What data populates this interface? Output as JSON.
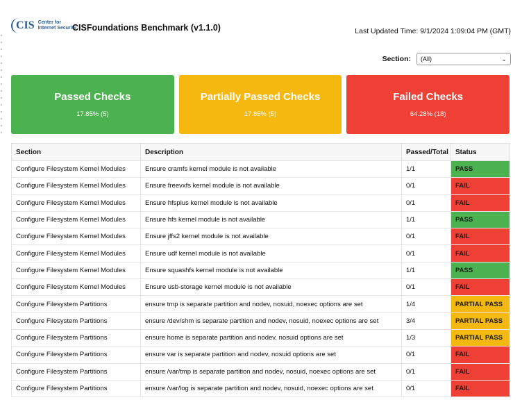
{
  "header": {
    "logo_mark": "CIS",
    "logo_line1": "Center for",
    "logo_line2": "Internet Security",
    "title": "CISFoundations Benchmark (v1.1.0)",
    "last_updated": "Last Updated Time: 9/1/2024 1:09:04 PM (GMT)"
  },
  "filter": {
    "label": "Section:",
    "selected": "(All)"
  },
  "cards": {
    "passed": {
      "title": "Passed Checks",
      "value": "17.85% (5)",
      "color": "#4cb14f"
    },
    "partial": {
      "title": "Partially Passed Checks",
      "value": "17.85% (5)",
      "color": "#f5b80f"
    },
    "failed": {
      "title": "Failed Checks",
      "value": "64.28% (18)",
      "color": "#ee4035"
    }
  },
  "table": {
    "columns": [
      "Section",
      "Description",
      "Passed/Total",
      "Status"
    ],
    "rows": [
      {
        "section": "Configure Filesystem Kernel Modules",
        "description": "Ensure cramfs kernel module is not available",
        "passed_total": "1/1",
        "status": "PASS"
      },
      {
        "section": "Configure Filesystem Kernel Modules",
        "description": "Ensure freevxfs kernel module is not available",
        "passed_total": "0/1",
        "status": "FAIL"
      },
      {
        "section": "Configure Filesystem Kernel Modules",
        "description": "Ensure hfsplus kernel module is not available",
        "passed_total": "0/1",
        "status": "FAIL"
      },
      {
        "section": "Configure Filesystem Kernel Modules",
        "description": "Ensure hfs kernel module is not available",
        "passed_total": "1/1",
        "status": "PASS"
      },
      {
        "section": "Configure Filesystem Kernel Modules",
        "description": "Ensure jffs2 kernel module is not available",
        "passed_total": "0/1",
        "status": "FAIL"
      },
      {
        "section": "Configure Filesystem Kernel Modules",
        "description": "Ensure udf kernel module is not available",
        "passed_total": "0/1",
        "status": "FAIL"
      },
      {
        "section": "Configure Filesystem Kernel Modules",
        "description": "Ensure squashfs kernel module is not available",
        "passed_total": "1/1",
        "status": "PASS"
      },
      {
        "section": "Configure Filesystem Kernel Modules",
        "description": "Ensure usb-storage kernel module is not available",
        "passed_total": "0/1",
        "status": "FAIL"
      },
      {
        "section": "Configure Filesystem Partitions",
        "description": "ensure tmp is separate partition and nodev, nosuid, noexec options are set",
        "passed_total": "1/4",
        "status": "PARTIAL PASS"
      },
      {
        "section": "Configure Filesystem Partitions",
        "description": "ensure /dev/shm is separate partition and nodev, nosuid, noexec options are set",
        "passed_total": "3/4",
        "status": "PARTIAL PASS"
      },
      {
        "section": "Configure Filesystem Partitions",
        "description": "ensure home is separate partition and nodev, nosuid options are set",
        "passed_total": "1/3",
        "status": "PARTIAL PASS"
      },
      {
        "section": "Configure Filesystem Partitions",
        "description": "ensure var is separate partition and nodev, nosuid options are set",
        "passed_total": "0/1",
        "status": "FAIL"
      },
      {
        "section": "Configure Filesystem Partitions",
        "description": "ensure /var/tmp is separate partition and nodev, nosuid, noexec options are set",
        "passed_total": "0/1",
        "status": "FAIL"
      },
      {
        "section": "Configure Filesystem Partitions",
        "description": "ensure /var/log is separate partition and nodev, nosuid, noexec options are set",
        "passed_total": "0/1",
        "status": "FAIL"
      }
    ]
  }
}
